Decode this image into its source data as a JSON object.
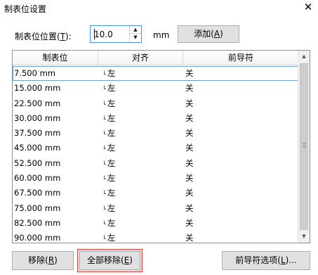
{
  "dialog": {
    "title": "制表位设置"
  },
  "position": {
    "label_prefix": "制表位位置(",
    "label_key": "T",
    "label_suffix": "):",
    "value": "10.0",
    "unit": "mm"
  },
  "buttons": {
    "add_prefix": "添加(",
    "add_key": "A",
    "add_suffix": ")",
    "remove_prefix": "移除(",
    "remove_key": "R",
    "remove_suffix": ")",
    "remove_all_prefix": "全部移除(",
    "remove_all_key": "E",
    "remove_all_suffix": ")",
    "leader_prefix": "前导符选项(",
    "leader_key": "L",
    "leader_suffix": ")..."
  },
  "table": {
    "headers": [
      "制表位",
      "对齐",
      "前导符"
    ],
    "rows": [
      {
        "pos": "7.500 mm",
        "align": "左",
        "leader": "关"
      },
      {
        "pos": "15.000 mm",
        "align": "左",
        "leader": "关"
      },
      {
        "pos": "22.500 mm",
        "align": "左",
        "leader": "关"
      },
      {
        "pos": "30.000 mm",
        "align": "左",
        "leader": "关"
      },
      {
        "pos": "37.500 mm",
        "align": "左",
        "leader": "关"
      },
      {
        "pos": "45.000 mm",
        "align": "左",
        "leader": "关"
      },
      {
        "pos": "52.500 mm",
        "align": "左",
        "leader": "关"
      },
      {
        "pos": "60.000 mm",
        "align": "左",
        "leader": "关"
      },
      {
        "pos": "67.500 mm",
        "align": "左",
        "leader": "关"
      },
      {
        "pos": "75.000 mm",
        "align": "左",
        "leader": "关"
      },
      {
        "pos": "82.500 mm",
        "align": "左",
        "leader": "关"
      },
      {
        "pos": "90.000 mm",
        "align": "左",
        "leader": "关"
      }
    ]
  }
}
